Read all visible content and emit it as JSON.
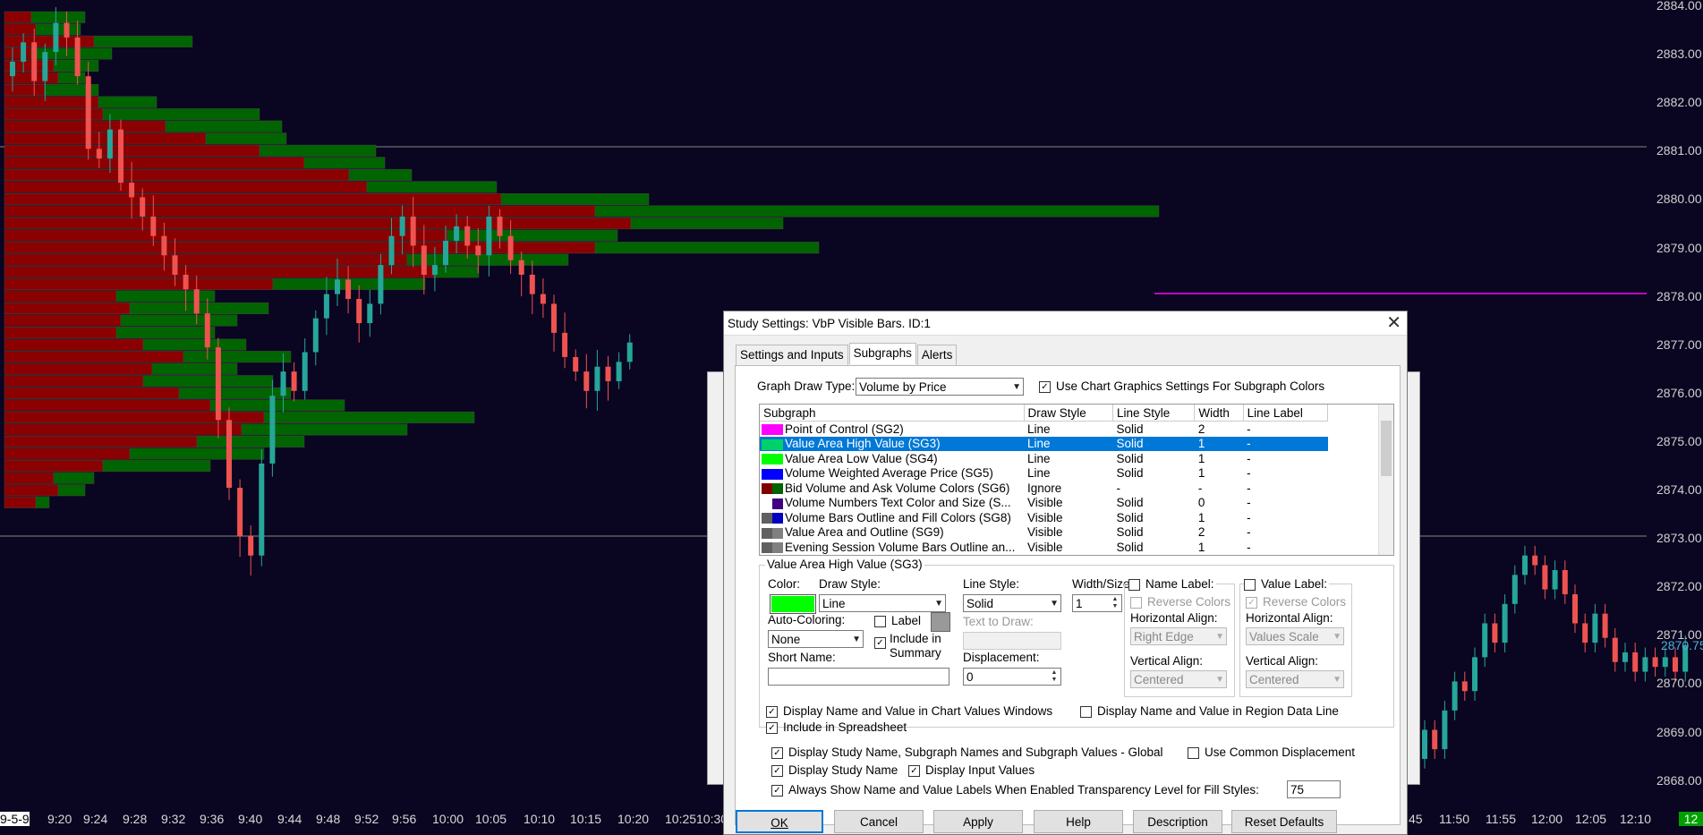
{
  "chart": {
    "price_labels": [
      "2884.00",
      "2883.00",
      "2882.00",
      "2881.00",
      "2880.00",
      "2879.00",
      "2878.00",
      "2877.00",
      "2876.00",
      "2875.00",
      "2874.00",
      "2873.00",
      "2872.00",
      "2871.00",
      "2870.00",
      "2869.00",
      "2868.00"
    ],
    "current_price": "2870.75",
    "time_labels_left": [
      "9-5-9",
      "9:20",
      "9:24",
      "9:28",
      "9:32",
      "9:36",
      "9:40",
      "9:44",
      "9:48",
      "9:52",
      "9:56",
      "10:00",
      "10:05",
      "10:10",
      "10:15",
      "10:20",
      "10:25",
      "10:30"
    ],
    "time_labels_right": [
      "45",
      "11:50",
      "11:55",
      "12:00",
      "12:05",
      "12:10"
    ],
    "corner_label": "12",
    "colors": {
      "background": "#0a0520",
      "ask_volume": "#006400",
      "bid_volume": "#8b0000",
      "up_candle": "#26a69a",
      "down_candle": "#ef5350",
      "poc_line": "#ff00ff"
    }
  },
  "dialog": {
    "title": "Study Settings: VbP Visible Bars. ID:1",
    "tabs": [
      "Settings and Inputs",
      "Subgraphs",
      "Alerts"
    ],
    "active_tab": "Subgraphs",
    "graph_draw_type_label": "Graph Draw Type:",
    "graph_draw_type_value": "Volume by Price",
    "use_chart_graphics_label": "Use Chart Graphics Settings For Subgraph Colors",
    "table": {
      "headers": [
        "Subgraph",
        "Draw Style",
        "Line Style",
        "Width",
        "Line Label"
      ],
      "rows": [
        {
          "name": "Point of Control (SG2)",
          "draw": "Line",
          "line": "Solid",
          "width": "2",
          "label": "-",
          "c1": "#ff00ff",
          "c2": "#ff00ff"
        },
        {
          "name": "Value Area High Value (SG3)",
          "draw": "Line",
          "line": "Solid",
          "width": "1",
          "label": "-",
          "c1": "#00d26a",
          "c2": "#00d26a"
        },
        {
          "name": "Value Area Low Value (SG4)",
          "draw": "Line",
          "line": "Solid",
          "width": "1",
          "label": "-",
          "c1": "#00ff00",
          "c2": "#00ff00"
        },
        {
          "name": "Volume Weighted Average Price (SG5)",
          "draw": "Line",
          "line": "Solid",
          "width": "1",
          "label": "-",
          "c1": "#0000ff",
          "c2": "#0000ff"
        },
        {
          "name": "Bid Volume and Ask Volume Colors (SG6)",
          "draw": "Ignore",
          "line": "-",
          "width": "-",
          "label": "-",
          "c1": "#800000",
          "c2": "#006400"
        },
        {
          "name": "Volume Numbers Text Color and Size (S...",
          "draw": "Visible",
          "line": "Solid",
          "width": "0",
          "label": "-",
          "c1": "#ffffff",
          "c2": "#400080"
        },
        {
          "name": "Volume Bars Outline and Fill Colors (SG8)",
          "draw": "Visible",
          "line": "Solid",
          "width": "1",
          "label": "-",
          "c1": "#606060",
          "c2": "#0000c0"
        },
        {
          "name": "Value Area and Outline (SG9)",
          "draw": "Visible",
          "line": "Solid",
          "width": "2",
          "label": "-",
          "c1": "#606060",
          "c2": "#808080"
        },
        {
          "name": "Evening Session Volume Bars Outline an...",
          "draw": "Visible",
          "line": "Solid",
          "width": "1",
          "label": "-",
          "c1": "#606060",
          "c2": "#808080"
        }
      ],
      "selected_index": 1
    },
    "group_title": "Value Area High Value (SG3)",
    "color_label": "Color:",
    "color_value": "#00ff00",
    "draw_style_label": "Draw Style:",
    "draw_style_value": "Line",
    "line_style_label": "Line Style:",
    "line_style_value": "Solid",
    "width_size_label": "Width/Size:",
    "width_size_value": "1",
    "name_label_label": "Name Label:",
    "value_label_label": "Value Label:",
    "reverse_colors_label": "Reverse Colors",
    "horizontal_align_label": "Horizontal Align:",
    "name_h_align_value": "Right Edge",
    "value_h_align_value": "Values Scale",
    "vertical_align_label": "Vertical Align:",
    "name_v_align_value": "Centered",
    "value_v_align_value": "Centered",
    "auto_coloring_label": "Auto-Coloring:",
    "auto_coloring_value": "None",
    "label_label": "Label",
    "include_summary_label_1": "Include in",
    "include_summary_label_2": "Summary",
    "text_to_draw_label": "Text to Draw:",
    "short_name_label": "Short Name:",
    "displacement_label": "Displacement:",
    "displacement_value": "0",
    "display_name_value_chart_label": "Display Name and Value in Chart Values Windows",
    "display_name_value_region_label": "Display Name and Value in Region Data Line",
    "include_spreadsheet_label": "Include in Spreadsheet",
    "display_global_label": "Display Study Name, Subgraph Names and Subgraph Values - Global",
    "use_common_displacement_label": "Use Common Displacement",
    "display_study_name_label": "Display Study Name",
    "display_input_values_label": "Display Input Values",
    "always_show_labels_label": "Always Show Name and Value Labels When Enabled",
    "transparency_label": "Transparency Level for Fill Styles:",
    "transparency_value": "75",
    "buttons": {
      "ok": "OK",
      "cancel": "Cancel",
      "apply": "Apply",
      "help": "Help",
      "description": "Description",
      "reset": "Reset Defaults"
    },
    "check_mark": "✓",
    "close_glyph": "✕",
    "arrow_glyph": "▼"
  }
}
